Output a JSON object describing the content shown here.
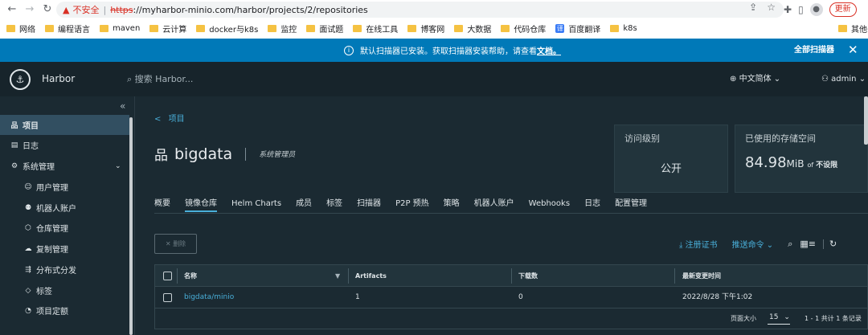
{
  "browser": {
    "security_label": "不安全",
    "url_scheme": "https",
    "url_rest": "://myharbor-minio.com/harbor/projects/2/repositories",
    "update_label": "更新",
    "bookmarks": [
      {
        "label": "网络",
        "icon": "folder-icon"
      },
      {
        "label": "编程语言",
        "icon": "folder-icon"
      },
      {
        "label": "maven",
        "icon": "folder-icon"
      },
      {
        "label": "云计算",
        "icon": "folder-icon"
      },
      {
        "label": "docker与k8s",
        "icon": "folder-icon"
      },
      {
        "label": "监控",
        "icon": "folder-icon"
      },
      {
        "label": "面试题",
        "icon": "folder-icon"
      },
      {
        "label": "在线工具",
        "icon": "folder-icon"
      },
      {
        "label": "博客网",
        "icon": "folder-icon"
      },
      {
        "label": "大数据",
        "icon": "folder-icon"
      },
      {
        "label": "代码仓库",
        "icon": "folder-icon"
      },
      {
        "label": "百度翻译",
        "icon": "translate-icon"
      },
      {
        "label": "k8s",
        "icon": "folder-icon"
      }
    ],
    "other_bookmarks": "其他书签"
  },
  "banner": {
    "message": "默认扫描器已安装。获取扫描器安装帮助，请查看",
    "doc_link": "文档。",
    "scan_all": "全部扫描器"
  },
  "header": {
    "brand": "Harbor",
    "search_placeholder": "搜索 Harbor...",
    "language": "中文简体",
    "user": "admin"
  },
  "sidebar": {
    "items": [
      {
        "label": "项目",
        "icon": "projects-icon",
        "active": true
      },
      {
        "label": "日志",
        "icon": "logs-icon"
      },
      {
        "label": "系统管理",
        "icon": "admin-icon"
      },
      {
        "label": "用户管理",
        "icon": "users-icon"
      },
      {
        "label": "机器人账户",
        "icon": "robot-icon"
      },
      {
        "label": "仓库管理",
        "icon": "registry-icon"
      },
      {
        "label": "复制管理",
        "icon": "replication-icon"
      },
      {
        "label": "分布式分发",
        "icon": "distribution-icon"
      },
      {
        "label": "标签",
        "icon": "tag-icon"
      },
      {
        "label": "项目定额",
        "icon": "quota-icon"
      }
    ]
  },
  "project": {
    "breadcrumb": "项目",
    "name": "bigdata",
    "role": "系统管理员"
  },
  "cards": {
    "access_title": "访问级别",
    "access_value": "公开",
    "storage_title": "已使用的存储空间",
    "storage_value": "84.98",
    "storage_unit": "MiB",
    "storage_of": "of",
    "storage_limit": "不设限"
  },
  "tabs": [
    {
      "label": "概要"
    },
    {
      "label": "镜像仓库",
      "active": true
    },
    {
      "label": "Helm Charts"
    },
    {
      "label": "成员"
    },
    {
      "label": "标签"
    },
    {
      "label": "扫描器"
    },
    {
      "label": "P2P 预热"
    },
    {
      "label": "策略"
    },
    {
      "label": "机器人账户"
    },
    {
      "label": "Webhooks"
    },
    {
      "label": "日志"
    },
    {
      "label": "配置管理"
    }
  ],
  "toolbar": {
    "delete_label": "删除",
    "register_cert": "注册证书",
    "push_command": "推送命令"
  },
  "table": {
    "headers": [
      "名称",
      "Artifacts",
      "下载数",
      "最新变更时间"
    ],
    "rows": [
      {
        "name": "bigdata/minio",
        "artifacts": "1",
        "pulls": "0",
        "updated": "2022/8/28 下午1:02"
      }
    ],
    "page_size_label": "页面大小",
    "page_size": "15",
    "total": "1 - 1 共计 1 条记录"
  }
}
